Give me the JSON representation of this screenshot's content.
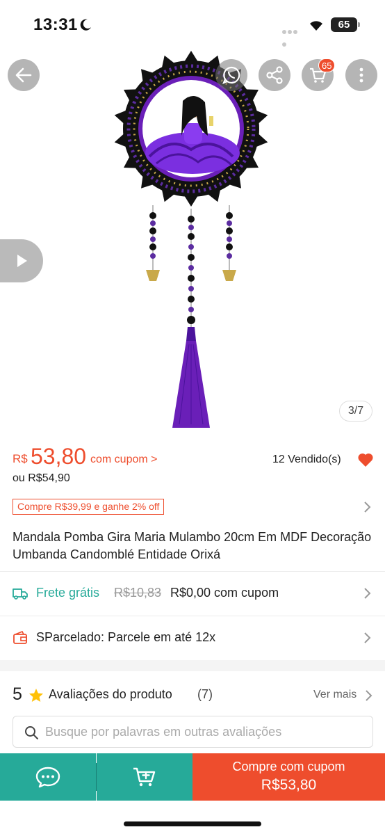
{
  "status_bar": {
    "time": "13:31",
    "battery": "65"
  },
  "gallery": {
    "cart_count": "65",
    "page_indicator": "3/7"
  },
  "price": {
    "currency": "R$",
    "value": "53,80",
    "coupon_link": "com cupom >",
    "sold": "12 Vendido(s)",
    "alternative": "ou R$54,90",
    "promo_tag": "Compre R$39,99 e ganhe 2% off"
  },
  "product": {
    "title": "Mandala Pomba Gira Maria Mulambo 20cm Em MDF Decoração Umbanda Candomblé Entidade Orixá"
  },
  "shipping": {
    "label": "Frete grátis",
    "old_price": "R$10,83",
    "new_price": "R$0,00 com cupom"
  },
  "installments": {
    "label": "SParcelado: Parcele em até 12x"
  },
  "reviews": {
    "rating": "5",
    "title": "Avaliações do produto",
    "count": "(7)",
    "see_more": "Ver mais",
    "search_placeholder": "Busque por palavras em outras avaliações"
  },
  "bottom_bar": {
    "buy_label": "Compre com cupom",
    "buy_price": "R$53,80"
  },
  "colors": {
    "accent": "#ee4d2d",
    "teal": "#26aa99",
    "product_purple": "#6a1fb8"
  },
  "icons": [
    "moon-icon",
    "wifi-icon",
    "back-arrow-icon",
    "whatsapp-icon",
    "share-icon",
    "cart-icon",
    "more-icon",
    "play-icon",
    "heart-icon",
    "truck-icon",
    "wallet-icon",
    "star-icon",
    "search-icon",
    "chat-icon",
    "add-to-cart-icon",
    "chevron-right-icon"
  ]
}
